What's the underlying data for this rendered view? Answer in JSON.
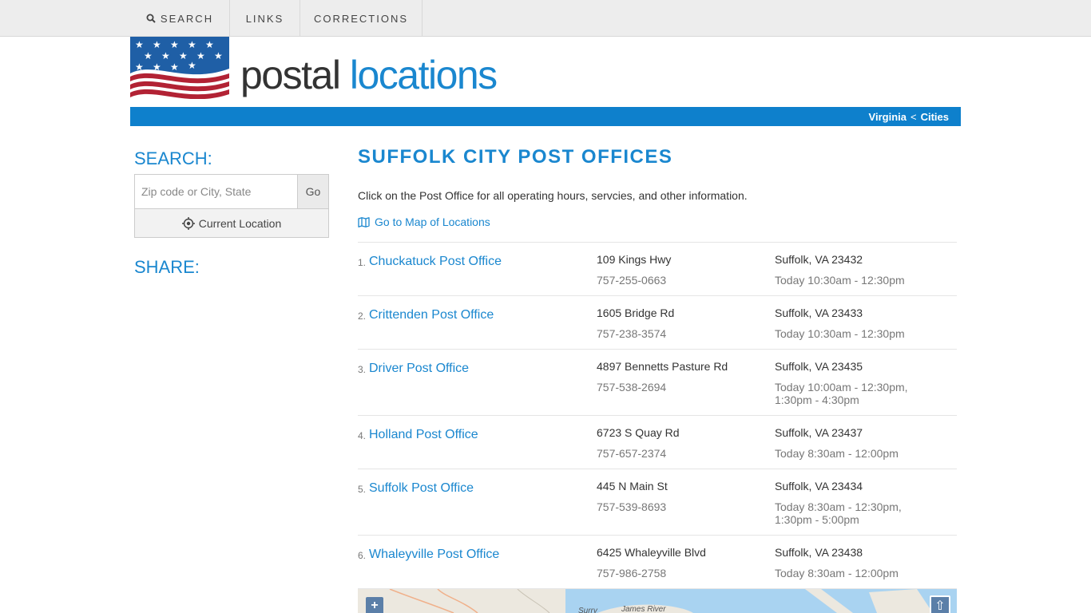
{
  "nav": {
    "search": "SEARCH",
    "links": "LINKS",
    "corrections": "CORRECTIONS"
  },
  "logo": {
    "part1": "postal",
    "part2": "locations"
  },
  "breadcrumb": {
    "state": "Virginia",
    "separator": "<",
    "cities": "Cities"
  },
  "sidebar": {
    "search_title": "SEARCH:",
    "search_placeholder": "Zip code or City, State",
    "go_label": "Go",
    "current_location_label": "Current Location",
    "share_title": "SHARE:"
  },
  "main": {
    "title": "SUFFOLK CITY POST OFFICES",
    "intro": "Click on the Post Office for all operating hours, servcies, and other information.",
    "map_link": "Go to Map of Locations"
  },
  "offices": [
    {
      "num": "1.",
      "name": "Chuckatuck Post Office",
      "address": "109 Kings Hwy",
      "phone": "757-255-0663",
      "city_zip": "Suffolk, VA 23432",
      "hours": "Today 10:30am - 12:30pm"
    },
    {
      "num": "2.",
      "name": "Crittenden Post Office",
      "address": "1605 Bridge Rd",
      "phone": "757-238-3574",
      "city_zip": "Suffolk, VA 23433",
      "hours": "Today 10:30am - 12:30pm"
    },
    {
      "num": "3.",
      "name": "Driver Post Office",
      "address": "4897 Bennetts Pasture Rd",
      "phone": "757-538-2694",
      "city_zip": "Suffolk, VA 23435",
      "hours": "Today 10:00am - 12:30pm, 1:30pm - 4:30pm"
    },
    {
      "num": "4.",
      "name": "Holland Post Office",
      "address": "6723 S Quay Rd",
      "phone": "757-657-2374",
      "city_zip": "Suffolk, VA 23437",
      "hours": "Today 8:30am - 12:00pm"
    },
    {
      "num": "5.",
      "name": "Suffolk Post Office",
      "address": "445 N Main St",
      "phone": "757-539-8693",
      "city_zip": "Suffolk, VA 23434",
      "hours": "Today 8:30am - 12:30pm, 1:30pm - 5:00pm"
    },
    {
      "num": "6.",
      "name": "Whaleyville Post Office",
      "address": "6425 Whaleyville Blvd",
      "phone": "757-986-2758",
      "city_zip": "Suffolk, VA 23438",
      "hours": "Today 8:30am - 12:00pm"
    }
  ],
  "map": {
    "zoom_in": "+",
    "fullscreen": "⇧",
    "label_surry": "Surry",
    "label_river": "James River"
  },
  "colors": {
    "accent": "#1a87cf",
    "bar": "#0e80cc"
  }
}
